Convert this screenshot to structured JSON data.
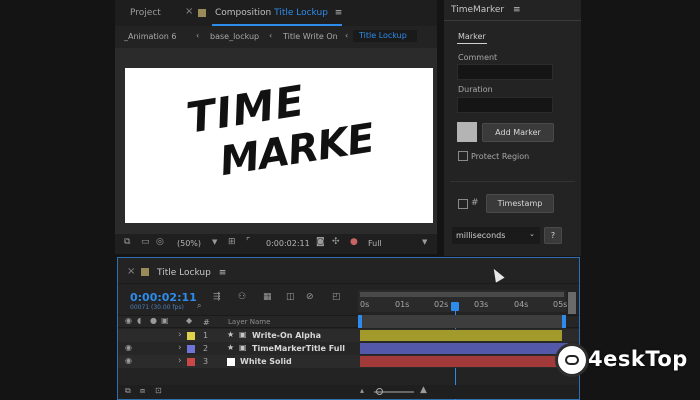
{
  "project_tab": {
    "label": "Project",
    "close": "×"
  },
  "comp_tab": {
    "prefix": "Composition",
    "name": "Title Lockup",
    "menu": "≡"
  },
  "breadcrumbs": [
    "_Animation 6",
    "base_lockup",
    "Title Write On",
    "Title Lockup"
  ],
  "viewer": {
    "text_line1": "TIME",
    "text_line2": "MARKE",
    "zoom": "(50%)",
    "timecode": "0:00:02:11",
    "resolution": "Full"
  },
  "marker_panel": {
    "title": "TimeMarker",
    "menu": "≡",
    "tab": "Marker",
    "comment_label": "Comment",
    "duration_label": "Duration",
    "add_marker": "Add Marker",
    "protect_region": "Protect Region",
    "timestamp": "Timestamp",
    "units": "milliseconds",
    "help": "?"
  },
  "timeline": {
    "close": "×",
    "title": "Title Lockup",
    "menu": "≡",
    "current_time": "0:00:02:11",
    "frame_info": "00071 (30.00 fps)",
    "ruler_labels": [
      "0s",
      "01s",
      "02s",
      "03s",
      "04s",
      "05s"
    ],
    "column_header": "Layer Name",
    "hash": "#",
    "layers": [
      {
        "num": "1",
        "name": "Write-On Alpha",
        "label_color": "#e0d34a",
        "bar_color": "#a39a2c"
      },
      {
        "num": "2",
        "name": "TimeMarkerTitle Full",
        "label_color": "#6f74d6",
        "bar_color": "#5458a8"
      },
      {
        "num": "3",
        "name": "White Solid",
        "label_color": "#c94747",
        "bar_color": "#a23a3a"
      }
    ]
  },
  "watermark": {
    "text": "4eskTop"
  },
  "colors": {
    "accent": "#2d8ceb",
    "panel": "#232323",
    "background": "#141414"
  }
}
